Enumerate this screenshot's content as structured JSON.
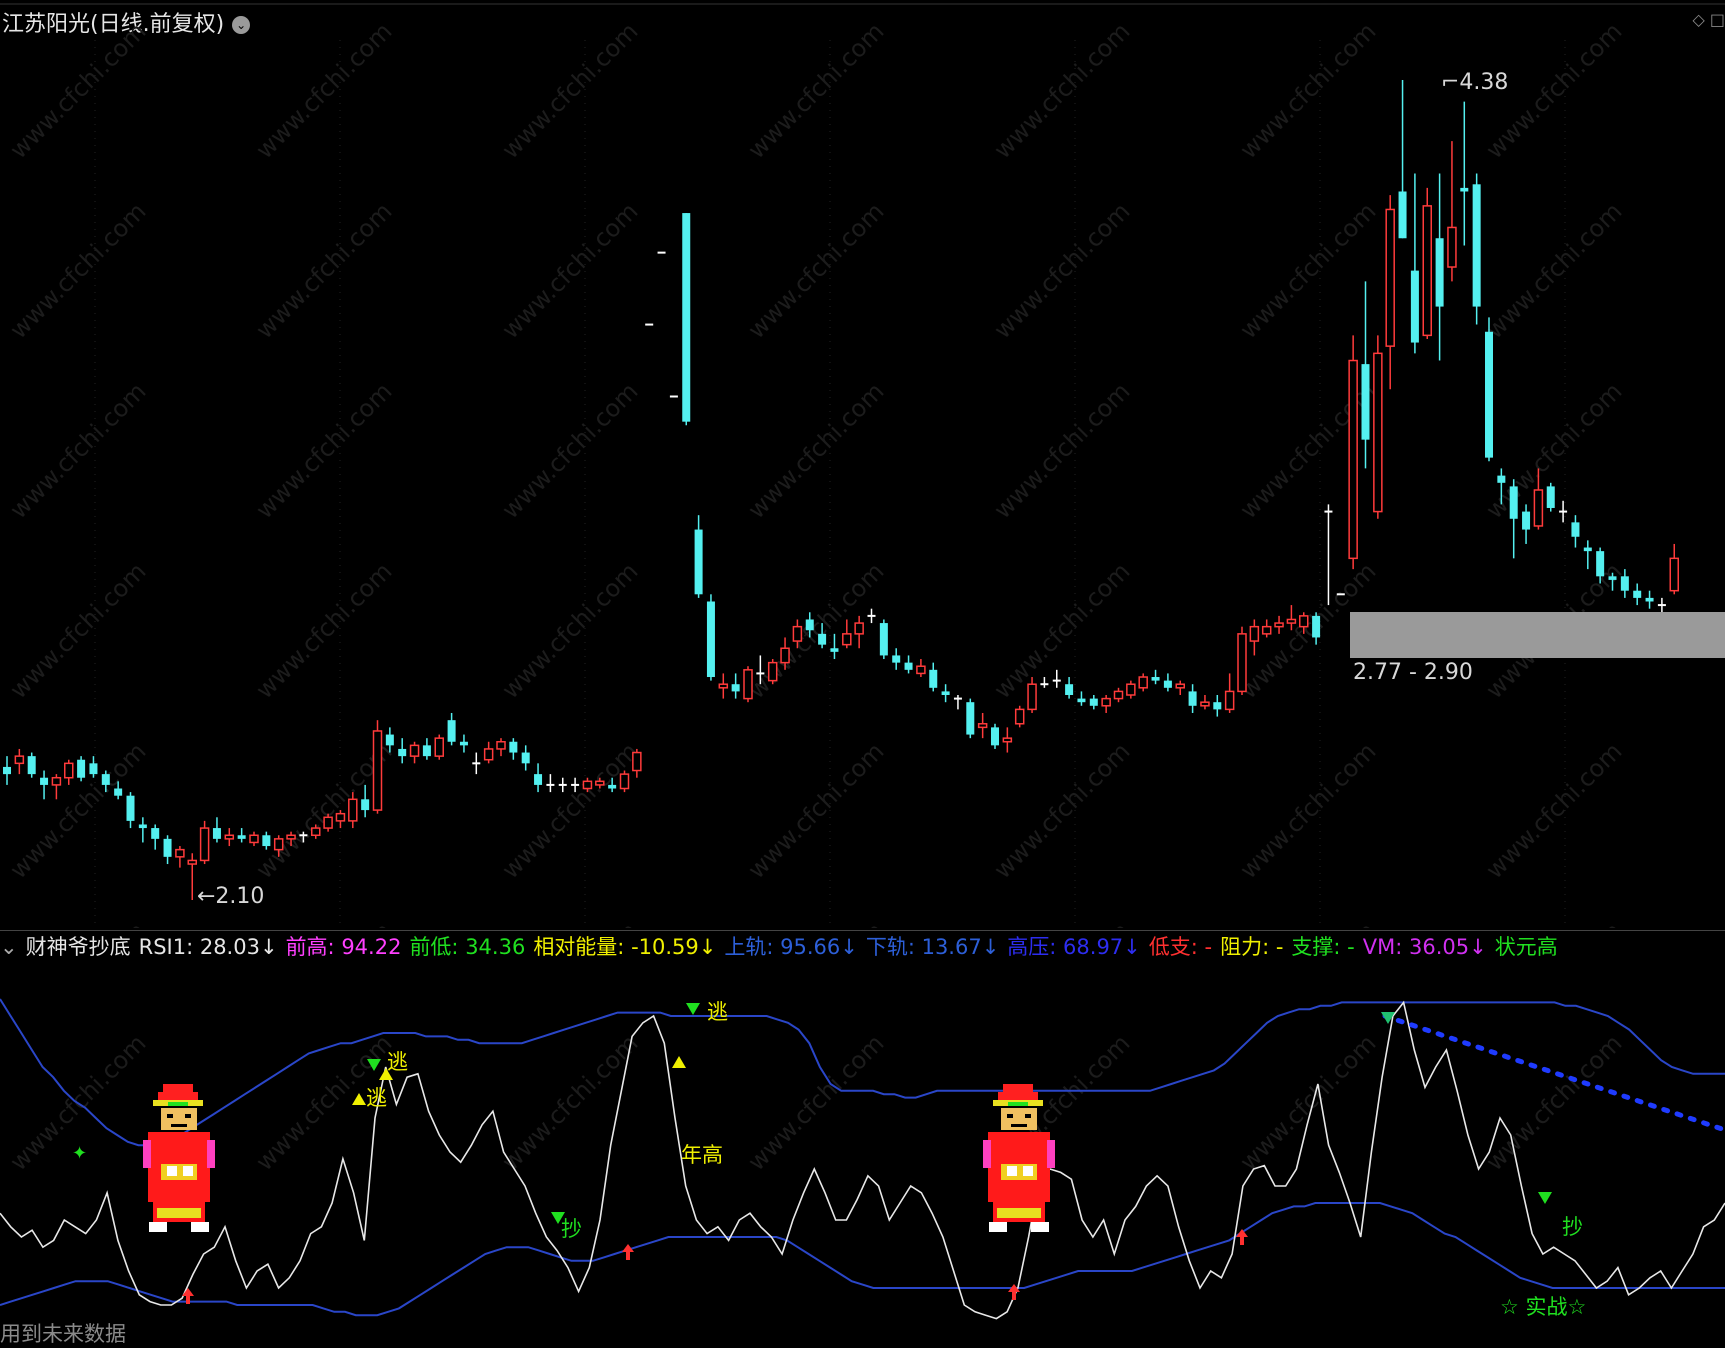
{
  "header": {
    "title": "江苏阳光(日线.前复权)",
    "dropdown_icon": "chevron-down-circle-icon",
    "right_icons": "◇ □"
  },
  "price_chart": {
    "high_label": "4.38",
    "low_label": "2.10",
    "zone_label": "2.77 - 2.90",
    "watermark": "www.cfchi.com",
    "colors": {
      "up": "#ff3b3b",
      "down": "#54f0f0",
      "flat": "#ffffff",
      "zone": "#9a9a9a"
    },
    "candles": [
      {
        "o": 2.47,
        "h": 2.5,
        "l": 2.42,
        "c": 2.45
      },
      {
        "o": 2.48,
        "h": 2.52,
        "l": 2.45,
        "c": 2.5
      },
      {
        "o": 2.5,
        "h": 2.51,
        "l": 2.44,
        "c": 2.45
      },
      {
        "o": 2.44,
        "h": 2.46,
        "l": 2.38,
        "c": 2.42
      },
      {
        "o": 2.42,
        "h": 2.45,
        "l": 2.38,
        "c": 2.44
      },
      {
        "o": 2.44,
        "h": 2.49,
        "l": 2.42,
        "c": 2.48
      },
      {
        "o": 2.49,
        "h": 2.5,
        "l": 2.43,
        "c": 2.44
      },
      {
        "o": 2.48,
        "h": 2.5,
        "l": 2.44,
        "c": 2.45
      },
      {
        "o": 2.45,
        "h": 2.46,
        "l": 2.4,
        "c": 2.42
      },
      {
        "o": 2.41,
        "h": 2.43,
        "l": 2.38,
        "c": 2.39
      },
      {
        "o": 2.39,
        "h": 2.4,
        "l": 2.3,
        "c": 2.32
      },
      {
        "o": 2.31,
        "h": 2.33,
        "l": 2.26,
        "c": 2.3
      },
      {
        "o": 2.3,
        "h": 2.31,
        "l": 2.24,
        "c": 2.27
      },
      {
        "o": 2.27,
        "h": 2.28,
        "l": 2.2,
        "c": 2.22
      },
      {
        "o": 2.22,
        "h": 2.25,
        "l": 2.19,
        "c": 2.24
      },
      {
        "o": 2.2,
        "h": 2.23,
        "l": 2.1,
        "c": 2.21
      },
      {
        "o": 2.21,
        "h": 2.32,
        "l": 2.2,
        "c": 2.3
      },
      {
        "o": 2.3,
        "h": 2.33,
        "l": 2.26,
        "c": 2.27
      },
      {
        "o": 2.27,
        "h": 2.3,
        "l": 2.25,
        "c": 2.28
      },
      {
        "o": 2.28,
        "h": 2.3,
        "l": 2.26,
        "c": 2.27
      },
      {
        "o": 2.26,
        "h": 2.29,
        "l": 2.25,
        "c": 2.28
      },
      {
        "o": 2.28,
        "h": 2.29,
        "l": 2.24,
        "c": 2.25
      },
      {
        "o": 2.24,
        "h": 2.28,
        "l": 2.22,
        "c": 2.27
      },
      {
        "o": 2.27,
        "h": 2.29,
        "l": 2.25,
        "c": 2.28
      },
      {
        "o": 2.28,
        "h": 2.29,
        "l": 2.26,
        "c": 2.28
      },
      {
        "o": 2.28,
        "h": 2.31,
        "l": 2.27,
        "c": 2.3
      },
      {
        "o": 2.3,
        "h": 2.34,
        "l": 2.29,
        "c": 2.33
      },
      {
        "o": 2.32,
        "h": 2.35,
        "l": 2.3,
        "c": 2.34
      },
      {
        "o": 2.32,
        "h": 2.4,
        "l": 2.3,
        "c": 2.38
      },
      {
        "o": 2.38,
        "h": 2.42,
        "l": 2.33,
        "c": 2.35
      },
      {
        "o": 2.35,
        "h": 2.6,
        "l": 2.34,
        "c": 2.57
      },
      {
        "o": 2.56,
        "h": 2.58,
        "l": 2.51,
        "c": 2.53
      },
      {
        "o": 2.52,
        "h": 2.55,
        "l": 2.48,
        "c": 2.5
      },
      {
        "o": 2.5,
        "h": 2.54,
        "l": 2.48,
        "c": 2.53
      },
      {
        "o": 2.53,
        "h": 2.55,
        "l": 2.49,
        "c": 2.5
      },
      {
        "o": 2.5,
        "h": 2.56,
        "l": 2.49,
        "c": 2.55
      },
      {
        "o": 2.6,
        "h": 2.62,
        "l": 2.53,
        "c": 2.54
      },
      {
        "o": 2.54,
        "h": 2.56,
        "l": 2.51,
        "c": 2.53
      },
      {
        "o": 2.48,
        "h": 2.51,
        "l": 2.45,
        "c": 2.48
      },
      {
        "o": 2.49,
        "h": 2.54,
        "l": 2.48,
        "c": 2.52
      },
      {
        "o": 2.52,
        "h": 2.55,
        "l": 2.5,
        "c": 2.54
      },
      {
        "o": 2.54,
        "h": 2.55,
        "l": 2.49,
        "c": 2.51
      },
      {
        "o": 2.51,
        "h": 2.53,
        "l": 2.46,
        "c": 2.48
      },
      {
        "o": 2.45,
        "h": 2.48,
        "l": 2.4,
        "c": 2.42
      },
      {
        "o": 2.42,
        "h": 2.45,
        "l": 2.4,
        "c": 2.42
      },
      {
        "o": 2.42,
        "h": 2.44,
        "l": 2.4,
        "c": 2.42
      },
      {
        "o": 2.42,
        "h": 2.44,
        "l": 2.4,
        "c": 2.42
      },
      {
        "o": 2.41,
        "h": 2.44,
        "l": 2.4,
        "c": 2.43
      },
      {
        "o": 2.42,
        "h": 2.44,
        "l": 2.41,
        "c": 2.43
      },
      {
        "o": 2.42,
        "h": 2.44,
        "l": 2.4,
        "c": 2.41
      },
      {
        "o": 2.41,
        "h": 2.46,
        "l": 2.4,
        "c": 2.45
      },
      {
        "o": 2.46,
        "h": 2.52,
        "l": 2.44,
        "c": 2.51
      },
      {
        "o": 3.7,
        "h": 3.7,
        "l": 3.7,
        "c": 3.7
      },
      {
        "o": 3.9,
        "h": 3.9,
        "l": 3.9,
        "c": 3.9
      },
      {
        "o": 3.5,
        "h": 3.5,
        "l": 3.5,
        "c": 3.5
      },
      {
        "o": 4.01,
        "h": 4.01,
        "l": 3.42,
        "c": 3.43
      },
      {
        "o": 3.13,
        "h": 3.17,
        "l": 2.94,
        "c": 2.95
      },
      {
        "o": 2.93,
        "h": 2.95,
        "l": 2.71,
        "c": 2.72
      },
      {
        "o": 2.69,
        "h": 2.73,
        "l": 2.66,
        "c": 2.7
      },
      {
        "o": 2.7,
        "h": 2.73,
        "l": 2.66,
        "c": 2.68
      },
      {
        "o": 2.66,
        "h": 2.75,
        "l": 2.65,
        "c": 2.74
      },
      {
        "o": 2.73,
        "h": 2.78,
        "l": 2.7,
        "c": 2.73
      },
      {
        "o": 2.71,
        "h": 2.77,
        "l": 2.7,
        "c": 2.76
      },
      {
        "o": 2.76,
        "h": 2.83,
        "l": 2.74,
        "c": 2.8
      },
      {
        "o": 2.82,
        "h": 2.88,
        "l": 2.8,
        "c": 2.86
      },
      {
        "o": 2.88,
        "h": 2.9,
        "l": 2.83,
        "c": 2.85
      },
      {
        "o": 2.84,
        "h": 2.87,
        "l": 2.8,
        "c": 2.81
      },
      {
        "o": 2.8,
        "h": 2.84,
        "l": 2.77,
        "c": 2.79
      },
      {
        "o": 2.81,
        "h": 2.88,
        "l": 2.8,
        "c": 2.84
      },
      {
        "o": 2.84,
        "h": 2.89,
        "l": 2.8,
        "c": 2.87
      },
      {
        "o": 2.89,
        "h": 2.91,
        "l": 2.87,
        "c": 2.89
      },
      {
        "o": 2.87,
        "h": 2.88,
        "l": 2.77,
        "c": 2.78
      },
      {
        "o": 2.78,
        "h": 2.8,
        "l": 2.74,
        "c": 2.76
      },
      {
        "o": 2.76,
        "h": 2.78,
        "l": 2.73,
        "c": 2.74
      },
      {
        "o": 2.73,
        "h": 2.77,
        "l": 2.72,
        "c": 2.75
      },
      {
        "o": 2.74,
        "h": 2.76,
        "l": 2.68,
        "c": 2.69
      },
      {
        "o": 2.68,
        "h": 2.7,
        "l": 2.65,
        "c": 2.67
      },
      {
        "o": 2.66,
        "h": 2.67,
        "l": 2.63,
        "c": 2.66
      },
      {
        "o": 2.65,
        "h": 2.66,
        "l": 2.55,
        "c": 2.56
      },
      {
        "o": 2.58,
        "h": 2.62,
        "l": 2.55,
        "c": 2.59
      },
      {
        "o": 2.58,
        "h": 2.59,
        "l": 2.52,
        "c": 2.53
      },
      {
        "o": 2.54,
        "h": 2.58,
        "l": 2.51,
        "c": 2.55
      },
      {
        "o": 2.59,
        "h": 2.64,
        "l": 2.58,
        "c": 2.63
      },
      {
        "o": 2.63,
        "h": 2.72,
        "l": 2.62,
        "c": 2.7
      },
      {
        "o": 2.7,
        "h": 2.72,
        "l": 2.69,
        "c": 2.7
      },
      {
        "o": 2.71,
        "h": 2.74,
        "l": 2.69,
        "c": 2.71
      },
      {
        "o": 2.7,
        "h": 2.72,
        "l": 2.66,
        "c": 2.67
      },
      {
        "o": 2.66,
        "h": 2.68,
        "l": 2.64,
        "c": 2.65
      },
      {
        "o": 2.66,
        "h": 2.67,
        "l": 2.63,
        "c": 2.64
      },
      {
        "o": 2.64,
        "h": 2.67,
        "l": 2.62,
        "c": 2.66
      },
      {
        "o": 2.66,
        "h": 2.69,
        "l": 2.65,
        "c": 2.68
      },
      {
        "o": 2.67,
        "h": 2.71,
        "l": 2.66,
        "c": 2.7
      },
      {
        "o": 2.69,
        "h": 2.73,
        "l": 2.68,
        "c": 2.72
      },
      {
        "o": 2.72,
        "h": 2.74,
        "l": 2.7,
        "c": 2.71
      },
      {
        "o": 2.71,
        "h": 2.73,
        "l": 2.68,
        "c": 2.69
      },
      {
        "o": 2.69,
        "h": 2.71,
        "l": 2.67,
        "c": 2.7
      },
      {
        "o": 2.68,
        "h": 2.7,
        "l": 2.62,
        "c": 2.64
      },
      {
        "o": 2.64,
        "h": 2.67,
        "l": 2.63,
        "c": 2.65
      },
      {
        "o": 2.65,
        "h": 2.67,
        "l": 2.61,
        "c": 2.63
      },
      {
        "o": 2.63,
        "h": 2.73,
        "l": 2.62,
        "c": 2.68
      },
      {
        "o": 2.68,
        "h": 2.86,
        "l": 2.67,
        "c": 2.84
      },
      {
        "o": 2.82,
        "h": 2.88,
        "l": 2.78,
        "c": 2.86
      },
      {
        "o": 2.84,
        "h": 2.88,
        "l": 2.83,
        "c": 2.86
      },
      {
        "o": 2.86,
        "h": 2.89,
        "l": 2.84,
        "c": 2.87
      },
      {
        "o": 2.87,
        "h": 2.92,
        "l": 2.85,
        "c": 2.88
      },
      {
        "o": 2.86,
        "h": 2.9,
        "l": 2.84,
        "c": 2.89
      },
      {
        "o": 2.89,
        "h": 2.9,
        "l": 2.81,
        "c": 2.83
      },
      {
        "o": 3.18,
        "h": 3.2,
        "l": 2.92,
        "c": 3.18
      },
      {
        "o": 2.95,
        "h": 2.95,
        "l": 2.95,
        "c": 2.95
      },
      {
        "o": 3.05,
        "h": 3.67,
        "l": 3.02,
        "c": 3.6
      },
      {
        "o": 3.59,
        "h": 3.82,
        "l": 3.3,
        "c": 3.38
      },
      {
        "o": 3.18,
        "h": 3.67,
        "l": 3.16,
        "c": 3.62
      },
      {
        "o": 3.64,
        "h": 4.06,
        "l": 3.52,
        "c": 4.02
      },
      {
        "o": 4.07,
        "h": 4.38,
        "l": 3.94,
        "c": 3.94
      },
      {
        "o": 3.85,
        "h": 4.12,
        "l": 3.62,
        "c": 3.65
      },
      {
        "o": 3.67,
        "h": 4.08,
        "l": 3.66,
        "c": 4.03
      },
      {
        "o": 3.94,
        "h": 4.12,
        "l": 3.6,
        "c": 3.75
      },
      {
        "o": 3.86,
        "h": 4.21,
        "l": 3.82,
        "c": 3.97
      },
      {
        "o": 4.08,
        "h": 4.32,
        "l": 3.92,
        "c": 4.07
      },
      {
        "o": 4.09,
        "h": 4.12,
        "l": 3.7,
        "c": 3.75
      },
      {
        "o": 3.68,
        "h": 3.72,
        "l": 3.32,
        "c": 3.33
      },
      {
        "o": 3.28,
        "h": 3.3,
        "l": 3.2,
        "c": 3.26
      },
      {
        "o": 3.25,
        "h": 3.27,
        "l": 3.05,
        "c": 3.16
      },
      {
        "o": 3.18,
        "h": 3.2,
        "l": 3.09,
        "c": 3.13
      },
      {
        "o": 3.14,
        "h": 3.3,
        "l": 3.13,
        "c": 3.24
      },
      {
        "o": 3.25,
        "h": 3.26,
        "l": 3.18,
        "c": 3.19
      },
      {
        "o": 3.18,
        "h": 3.21,
        "l": 3.15,
        "c": 3.18
      },
      {
        "o": 3.15,
        "h": 3.17,
        "l": 3.08,
        "c": 3.11
      },
      {
        "o": 3.08,
        "h": 3.1,
        "l": 3.02,
        "c": 3.07
      },
      {
        "o": 3.07,
        "h": 3.08,
        "l": 2.98,
        "c": 3.0
      },
      {
        "o": 3.0,
        "h": 3.01,
        "l": 2.96,
        "c": 2.99
      },
      {
        "o": 3.0,
        "h": 3.02,
        "l": 2.94,
        "c": 2.96
      },
      {
        "o": 2.96,
        "h": 2.98,
        "l": 2.92,
        "c": 2.94
      },
      {
        "o": 2.94,
        "h": 2.96,
        "l": 2.91,
        "c": 2.93
      },
      {
        "o": 2.92,
        "h": 2.94,
        "l": 2.87,
        "c": 2.92
      },
      {
        "o": 2.96,
        "h": 3.09,
        "l": 2.95,
        "c": 3.05
      }
    ]
  },
  "indicator": {
    "name": "财神爷抄底",
    "items": [
      {
        "label": "RSI1: 28.03",
        "color": "#e6e6e6",
        "arrow": "↓"
      },
      {
        "label": "前高: 94.22",
        "color": "#ff40ff",
        "arrow": ""
      },
      {
        "label": "前低: 34.36",
        "color": "#20e020",
        "arrow": ""
      },
      {
        "label": "相对能量: -10.59",
        "color": "#f0f000",
        "arrow": "↓"
      },
      {
        "label": "上轨: 95.66",
        "color": "#2d5fd8",
        "arrow": "↓"
      },
      {
        "label": "下轨: 13.67",
        "color": "#2d5fd8",
        "arrow": "↓"
      },
      {
        "label": "高压: 68.97",
        "color": "#2d2df0",
        "arrow": "↓"
      },
      {
        "label": "低支: -",
        "color": "#ff3030",
        "arrow": ""
      },
      {
        "label": "阻力: -",
        "color": "#f0f000",
        "arrow": ""
      },
      {
        "label": "支撑: -",
        "color": "#20e020",
        "arrow": ""
      },
      {
        "label": "VM: 36.05",
        "color": "#d030f0",
        "arrow": "↓"
      },
      {
        "label": "状元高",
        "color": "#20e020",
        "arrow": ""
      }
    ],
    "rsi": [
      32,
      28,
      25,
      27,
      22,
      24,
      30,
      28,
      26,
      30,
      38,
      24,
      15,
      8,
      6,
      5,
      5,
      7,
      14,
      20,
      22,
      28,
      18,
      10,
      15,
      17,
      10,
      13,
      18,
      26,
      28,
      35,
      48,
      38,
      24,
      60,
      75,
      64,
      72,
      73,
      62,
      55,
      50,
      47,
      52,
      58,
      62,
      50,
      45,
      40,
      32,
      25,
      21,
      16,
      9,
      16,
      30,
      52,
      68,
      84,
      88,
      90,
      82,
      60,
      40,
      30,
      26,
      28,
      24,
      30,
      32,
      28,
      25,
      20,
      30,
      38,
      45,
      38,
      30,
      30,
      36,
      43,
      40,
      30,
      35,
      40,
      38,
      32,
      25,
      15,
      5,
      3,
      2,
      1,
      3,
      10,
      25,
      42,
      45,
      44,
      42,
      30,
      25,
      30,
      20,
      30,
      34,
      40,
      43,
      40,
      28,
      18,
      10,
      15,
      13,
      20,
      40,
      45,
      46,
      40,
      40,
      45,
      58,
      70,
      52,
      44,
      35,
      25,
      50,
      72,
      90,
      94,
      80,
      69,
      75,
      80,
      68,
      55,
      45,
      50,
      60,
      55,
      40,
      26,
      20,
      22,
      20,
      18,
      14,
      10,
      12,
      16,
      8,
      10,
      13,
      15,
      10,
      15,
      20,
      28,
      30,
      35
    ],
    "upper": [
      95,
      90,
      85,
      80,
      75,
      72,
      68,
      65,
      63,
      60,
      57,
      55,
      53,
      52,
      52,
      52,
      53,
      55,
      57,
      59,
      61,
      63,
      65,
      67,
      69,
      71,
      73,
      75,
      77,
      79,
      80,
      81,
      82,
      82,
      83,
      84,
      85,
      85,
      85,
      85,
      84,
      84,
      84,
      83,
      83,
      82,
      82,
      82,
      82,
      82,
      83,
      84,
      85,
      86,
      87,
      88,
      89,
      90,
      91,
      91,
      91,
      91,
      91,
      90,
      90,
      90,
      90,
      90,
      90,
      90,
      90,
      90,
      90,
      89,
      88,
      86,
      82,
      75,
      70,
      68,
      68,
      68,
      68,
      67,
      67,
      66,
      66,
      67,
      68,
      68,
      68,
      68,
      68,
      68,
      68,
      68,
      68,
      68,
      68,
      68,
      68,
      68,
      68,
      68,
      68,
      68,
      68,
      68,
      68,
      69,
      70,
      71,
      72,
      73,
      74,
      76,
      79,
      82,
      85,
      88,
      90,
      91,
      92,
      92,
      93,
      93,
      94,
      94,
      94,
      94,
      94,
      94,
      94,
      94,
      94,
      94,
      94,
      94,
      94,
      94,
      94,
      94,
      94,
      94,
      94,
      94,
      94,
      93,
      93,
      92,
      91,
      90,
      88,
      86,
      83,
      80,
      77,
      75,
      74,
      73,
      73,
      73,
      73
    ],
    "lower": [
      5,
      6,
      7,
      8,
      9,
      10,
      11,
      12,
      12,
      12,
      12,
      11,
      10,
      9,
      8,
      7,
      6,
      6,
      6,
      6,
      6,
      6,
      5,
      5,
      5,
      5,
      5,
      5,
      5,
      5,
      4,
      3,
      3,
      2,
      2,
      2,
      3,
      4,
      6,
      8,
      10,
      12,
      14,
      16,
      18,
      20,
      21,
      22,
      22,
      22,
      21,
      20,
      19,
      18,
      18,
      18,
      19,
      20,
      21,
      22,
      23,
      24,
      25,
      25,
      25,
      25,
      25,
      25,
      25,
      25,
      25,
      25,
      25,
      24,
      22,
      20,
      18,
      16,
      14,
      12,
      11,
      10,
      10,
      10,
      10,
      10,
      10,
      10,
      10,
      10,
      10,
      10,
      10,
      10,
      10,
      10,
      11,
      12,
      13,
      14,
      15,
      15,
      15,
      15,
      15,
      15,
      16,
      17,
      18,
      19,
      20,
      21,
      22,
      23,
      24,
      26,
      28,
      30,
      32,
      33,
      34,
      34,
      35,
      35,
      35,
      35,
      35,
      35,
      35,
      34,
      33,
      32,
      30,
      28,
      26,
      25,
      23,
      21,
      19,
      17,
      15,
      13,
      12,
      11,
      10,
      10,
      10,
      10,
      10,
      10,
      10,
      10,
      10,
      10,
      10,
      10,
      10,
      10,
      10,
      10,
      10
    ],
    "signals": {
      "escape": "逃",
      "bottom": "抄",
      "year_high": "年高",
      "actual": "☆ 实战☆"
    },
    "footer_note": "用到未来数据"
  }
}
